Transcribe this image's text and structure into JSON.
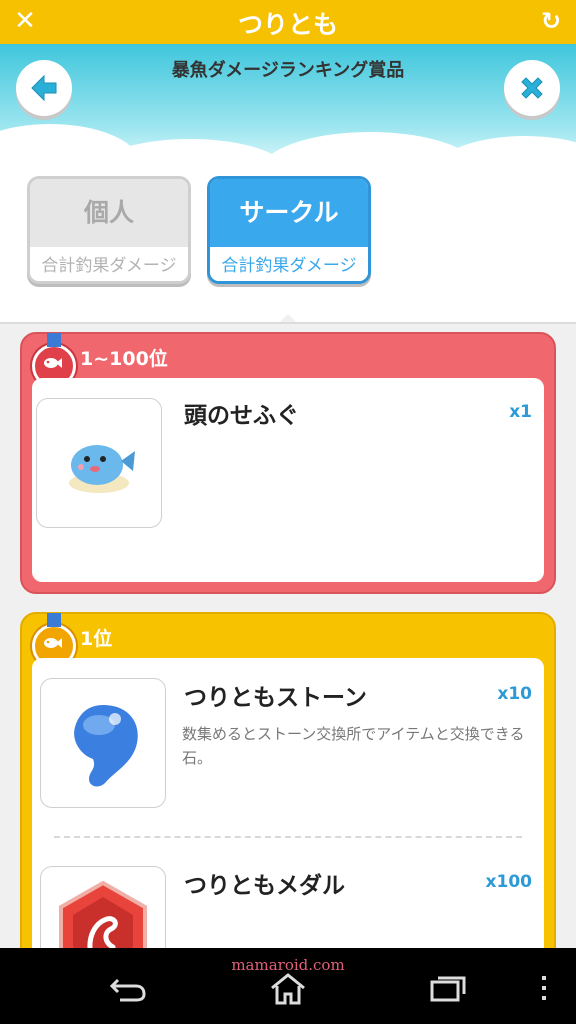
{
  "app": {
    "title": "つりとも"
  },
  "header": {
    "subtitle": "暴魚ダメージランキング賞品"
  },
  "tabs": [
    {
      "label": "個人",
      "sub": "合計釣果ダメージ",
      "selected": false
    },
    {
      "label": "サークル",
      "sub": "合計釣果ダメージ",
      "selected": true
    }
  ],
  "rewards": [
    {
      "rank": "1~100位",
      "color": "#f0686d",
      "items": [
        {
          "name": "頭のせふぐ",
          "qty": "x1",
          "icon": "pufferfish-icon"
        }
      ]
    },
    {
      "rank": "1位",
      "color": "#f7c200",
      "items": [
        {
          "name": "つりともストーン",
          "qty": "x10",
          "desc": "数集めるとストーン交換所でアイテムと交換できる石。",
          "icon": "blue-stone-icon"
        },
        {
          "name": "つりともメダル",
          "qty": "x100",
          "icon": "red-medal-icon"
        }
      ]
    }
  ],
  "watermark": "mamaroid.com",
  "colors": {
    "topbar": "#f5c100",
    "accent_blue": "#3aa8ec",
    "qty_blue": "#2d9ad8"
  }
}
